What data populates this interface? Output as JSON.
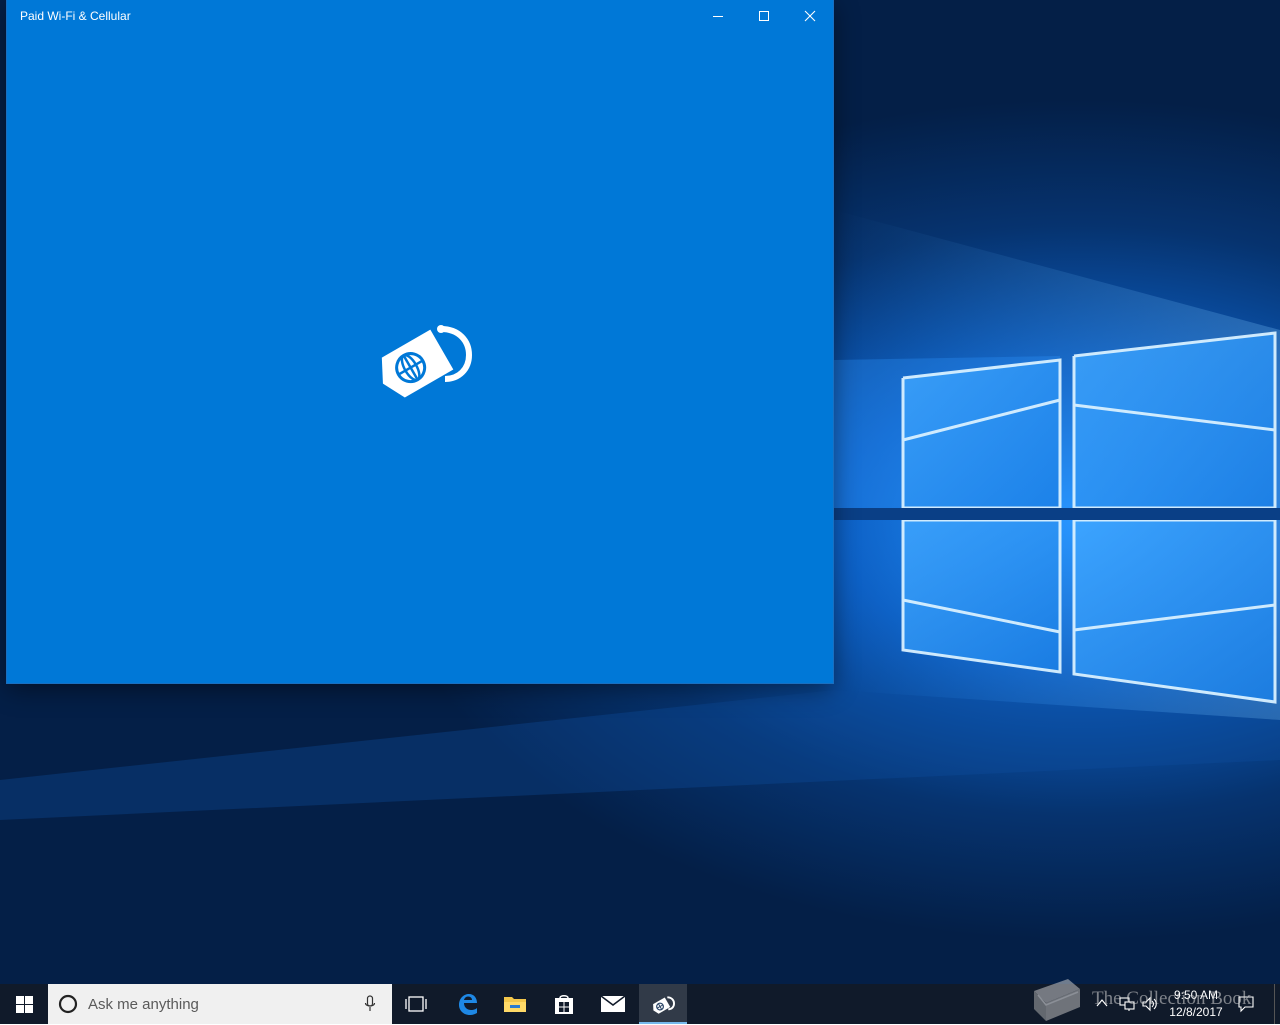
{
  "window": {
    "title": "Paid Wi-Fi & Cellular",
    "background": "#0078d7",
    "logo_icon": "sim-globe-tag-icon"
  },
  "caption_buttons": {
    "minimize_icon": "minimize-icon",
    "maximize_icon": "maximize-icon",
    "close_icon": "close-icon"
  },
  "taskbar": {
    "background": "#101a2a",
    "search": {
      "placeholder": "Ask me anything",
      "cortana_icon": "cortana-circle-icon",
      "mic_icon": "microphone-icon"
    },
    "pinned_apps": [
      {
        "name": "Task View",
        "icon": "task-view-icon"
      },
      {
        "name": "Microsoft Edge",
        "icon": "edge-icon"
      },
      {
        "name": "File Explorer",
        "icon": "folder-icon"
      },
      {
        "name": "Store",
        "icon": "store-bag-icon"
      },
      {
        "name": "Mail",
        "icon": "mail-icon"
      },
      {
        "name": "Paid Wi-Fi & Cellular",
        "icon": "sim-globe-tag-icon",
        "active": true
      }
    ],
    "tray": {
      "time": "9:50 AM",
      "date": "12/8/2017"
    }
  },
  "watermark": {
    "text": "The Collection Book"
  }
}
